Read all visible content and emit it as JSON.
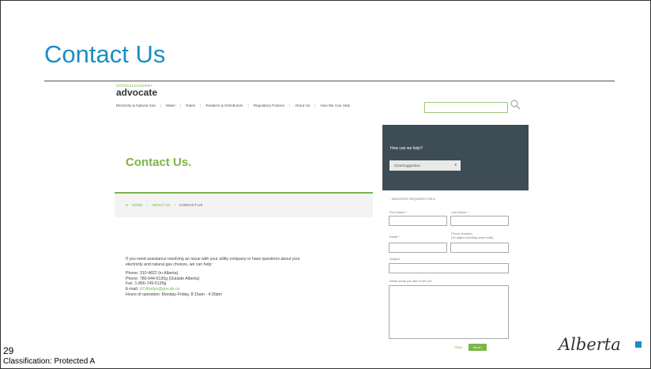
{
  "slide": {
    "title": "Contact Us",
    "page_number": "29",
    "classification": "Classification: Protected A",
    "logo_text": "Alberta",
    "accent_color": "#1a8fc4"
  },
  "screenshot": {
    "brand_small": "utilitiesconsumer",
    "brand_big": "advocate",
    "nav": [
      "Electricity & Natural Gas",
      "Water",
      "Rates",
      "Retailers & Distributors",
      "Regulatory Policies",
      "About Us",
      "How We Can Help"
    ],
    "hero_title": "Contact Us.",
    "breadcrumb": [
      "HOME",
      "ABOUT US",
      "CONTACT US"
    ],
    "help_question": "How can we help?",
    "help_select": "Give/Suggestion",
    "form": {
      "required_note": "* INDICATES REQUIRED FIELD",
      "first_name": "First Name *",
      "last_name": "Last Name *",
      "email": "Email *",
      "phone_label": "Phone Number",
      "phone_hint": "(10 digits including area code)",
      "subject": "Subject",
      "message": "What would you like to tell us?",
      "clear": "Clear",
      "send": "Send ›"
    },
    "intro": "If you need assistance resolving an issue with your utility company or have questions about your electricity and natural gas choices, we can help:",
    "phone1": "Phone: 310-4822 (in Alberta)",
    "phone2": "Phone: 780-644-5130g (Outside Alberta)",
    "fax": "Fax: 1-866-749-5135g",
    "email_label": "E-mail: ",
    "email_value": "UCAhelps@gov.ab.ca",
    "hours": "Hours of operation: Monday-Friday, 8:15am - 4:30pm"
  }
}
